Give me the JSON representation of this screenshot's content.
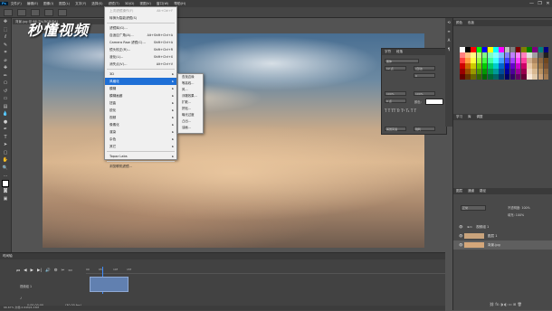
{
  "menubar": {
    "items": [
      "文件(F)",
      "编辑(E)",
      "图像(I)",
      "图层(L)",
      "文字(Y)",
      "选择(S)",
      "滤镜(T)",
      "3D(D)",
      "视图(V)",
      "窗口(W)",
      "帮助(H)"
    ]
  },
  "window_controls": [
    "—",
    "❐",
    "✕"
  ],
  "doc_tab": "背景.jpg @ 66.7%(RGB/8#)",
  "watermark": "秒懂视频",
  "filter_menu": {
    "items": [
      {
        "label": "上次滤镜操作(F)",
        "shortcut": "Alt+Ctrl+F",
        "disabled": true
      },
      {
        "label": "转换为智能滤镜(S)",
        "shortcut": ""
      },
      {
        "sep": true
      },
      {
        "label": "滤镜库(G)...",
        "shortcut": ""
      },
      {
        "label": "自适应广角(A)...",
        "shortcut": "Alt+Shift+Ctrl+A"
      },
      {
        "label": "Camera Raw 滤镜(C)...",
        "shortcut": "Shift+Ctrl+A"
      },
      {
        "label": "镜头校正(R)...",
        "shortcut": "Shift+Ctrl+R"
      },
      {
        "label": "液化(L)...",
        "shortcut": "Shift+Ctrl+X"
      },
      {
        "label": "消失点(V)...",
        "shortcut": "Alt+Ctrl+V"
      },
      {
        "sep": true
      },
      {
        "label": "3D",
        "submenu": true
      },
      {
        "label": "风格化",
        "submenu": true,
        "selected": true
      },
      {
        "label": "模糊",
        "submenu": true
      },
      {
        "label": "模糊画廊",
        "submenu": true
      },
      {
        "label": "扭曲",
        "submenu": true
      },
      {
        "label": "锐化",
        "submenu": true
      },
      {
        "label": "视频",
        "submenu": true
      },
      {
        "label": "像素化",
        "submenu": true
      },
      {
        "label": "渲染",
        "submenu": true
      },
      {
        "label": "杂色",
        "submenu": true
      },
      {
        "label": "其它",
        "submenu": true
      },
      {
        "sep": true
      },
      {
        "label": "Topaz Labs",
        "submenu": true
      },
      {
        "sep": true
      },
      {
        "label": "浏览联机滤镜...",
        "shortcut": ""
      }
    ]
  },
  "stylize_submenu": [
    "查找边缘",
    "等高线...",
    "风...",
    "浮雕效果...",
    "扩散...",
    "拼贴...",
    "曝光过度",
    "凸出...",
    "油画..."
  ],
  "character_panel": {
    "tabs": [
      "字符",
      "段落"
    ],
    "font": "黑体",
    "size": "12 点",
    "leading": "(自动)",
    "tracking": "0",
    "vscale": "100%",
    "hscale": "100%",
    "baseline": "0 点",
    "color_label": "颜色:",
    "lang": "美国英语",
    "aa": "锐利"
  },
  "right_dock": {
    "swatches_tabs": [
      "颜色",
      "色板"
    ],
    "learn_tabs": [
      "学习",
      "库",
      "调整"
    ],
    "layers_tabs": [
      "图层",
      "通道",
      "路径"
    ],
    "blend_mode": "正常",
    "opacity": "不透明度: 100%",
    "fill": "填充: 100%",
    "layers": [
      {
        "name": "视频组 1",
        "group": true,
        "selected": false
      },
      {
        "name": "图层 1",
        "group": false,
        "selected": false
      },
      {
        "name": "背景.jpg",
        "group": false,
        "selected": true
      }
    ]
  },
  "swatch_colors": [
    "#ffffff",
    "#000000",
    "#ff0000",
    "#00ff00",
    "#0000ff",
    "#ffff00",
    "#00ffff",
    "#ff00ff",
    "#c0c0c0",
    "#808080",
    "#800000",
    "#808000",
    "#008000",
    "#800080",
    "#008080",
    "#000080",
    "#ff8080",
    "#ffbf80",
    "#ffff80",
    "#bfff80",
    "#80ff80",
    "#80ffbf",
    "#80ffff",
    "#80bfff",
    "#8080ff",
    "#bf80ff",
    "#ff80ff",
    "#ff80bf",
    "#e0e0e0",
    "#a0a0a0",
    "#606060",
    "#202020",
    "#ff4040",
    "#ff9f40",
    "#ffff40",
    "#9fff40",
    "#40ff40",
    "#40ff9f",
    "#40ffff",
    "#409fff",
    "#4040ff",
    "#9f40ff",
    "#ff40ff",
    "#ff409f",
    "#d0b090",
    "#b08860",
    "#906840",
    "#704820",
    "#cc0000",
    "#cc6600",
    "#cccc00",
    "#66cc00",
    "#00cc00",
    "#00cc66",
    "#00cccc",
    "#0066cc",
    "#0000cc",
    "#6600cc",
    "#cc00cc",
    "#cc0066",
    "#e8c8a8",
    "#c8a070",
    "#a07848",
    "#785030",
    "#990000",
    "#994c00",
    "#999900",
    "#4c9900",
    "#009900",
    "#00994c",
    "#009999",
    "#004c99",
    "#000099",
    "#4c0099",
    "#990099",
    "#99004c",
    "#f0d8c0",
    "#d8b890",
    "#b89060",
    "#906840",
    "#660000",
    "#663300",
    "#666600",
    "#336600",
    "#006600",
    "#006633",
    "#006666",
    "#003366",
    "#000066",
    "#330066",
    "#660066",
    "#660033",
    "#f8e8d8",
    "#e0c8a8",
    "#c8a078",
    "#a07850"
  ],
  "timeline": {
    "title": "时间轴",
    "track": "视频组 1",
    "audio": "♪",
    "ruler": [
      "00",
      "05f",
      "10f",
      "15f"
    ],
    "time": "0:00:00:00",
    "fps": "(30.00 fps)"
  },
  "status": "66.67%    文档:2.64M/4.33M"
}
